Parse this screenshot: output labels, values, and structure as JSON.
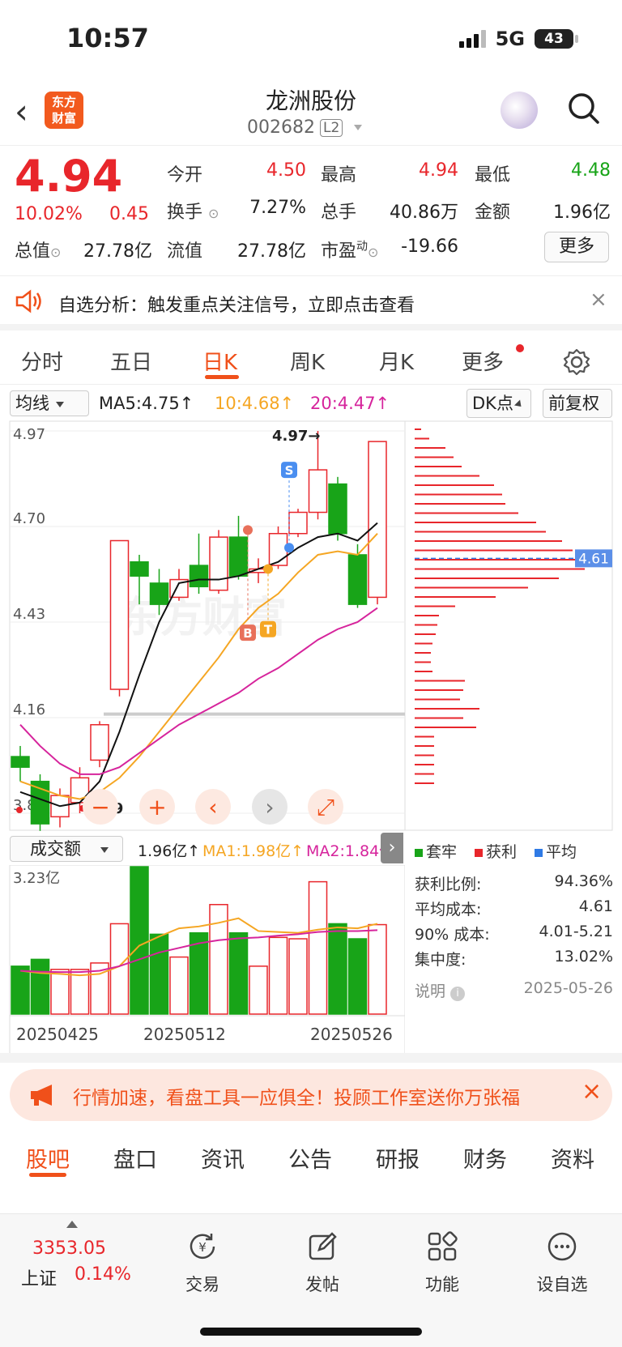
{
  "status_bar": {
    "time": "10:57",
    "network": "5G",
    "battery": "43"
  },
  "header": {
    "title": "龙洲股份",
    "code": "002682",
    "level_badge": "L2",
    "logo_text_line1": "东方",
    "logo_text_line2": "财富"
  },
  "quote": {
    "price": "4.94",
    "change_pct": "10.02%",
    "change_amt": "0.45",
    "open_label": "今开",
    "open": "4.50",
    "high_label": "最高",
    "high": "4.94",
    "low_label": "最低",
    "low": "4.48",
    "turnover_label": "换手",
    "turnover": "7.27%",
    "volume_label": "总手",
    "volume": "40.86万",
    "amount_label": "金额",
    "amount": "1.96亿",
    "total_cap_label": "总值",
    "total_cap": "27.78亿",
    "float_cap_label": "流值",
    "float_cap": "27.78亿",
    "pe_label": "市盈",
    "pe_super": "动",
    "pe": "-19.66",
    "more_button": "更多"
  },
  "alert_banner": {
    "text": "自选分析：触发重点关注信号，立即点击查看"
  },
  "chart_tabs": [
    "分时",
    "五日",
    "日K",
    "周K",
    "月K",
    "更多"
  ],
  "ma_bar": {
    "selector": "均线",
    "ma5": "MA5:4.75↑",
    "ma10": "10:4.68↑",
    "ma20": "20:4.47↑",
    "dk": "DK点",
    "adjust": "前复权"
  },
  "kline": {
    "y_labels": [
      "4.97",
      "4.70",
      "4.43",
      "4.16",
      "3.89"
    ],
    "high_marker": "4.97→",
    "low_marker": "3.89",
    "s_marker": "S",
    "b_marker": "B",
    "t_marker": "T",
    "cost_label": "4.61",
    "watermark": "东方财富"
  },
  "volume_bar": {
    "selector": "成交额",
    "value": "1.96亿↑",
    "ma1": "MA1:1.98亿↑",
    "ma2": "MA2:1.84亿↑",
    "max_label": "3.23亿"
  },
  "date_labels": [
    "20250425",
    "20250512",
    "20250526"
  ],
  "chip": {
    "legend": [
      "套牢",
      "获利",
      "平均"
    ],
    "profit_ratio_label": "获利比例:",
    "profit_ratio": "94.36%",
    "avg_cost_label": "平均成本:",
    "avg_cost": "4.61",
    "cost90_label": "90% 成本:",
    "cost90": "4.01-5.21",
    "concentration_label": "集中度:",
    "concentration": "13.02%",
    "note_label": "说明",
    "date": "2025-05-26"
  },
  "promo": {
    "text": "行情加速，看盘工具一应俱全！投顾工作室送你万张福"
  },
  "bottom_tabs": [
    "股吧",
    "盘口",
    "资讯",
    "公告",
    "研报",
    "财务",
    "资料"
  ],
  "bottom_nav": {
    "index_value": "3353.05",
    "index_name": "上证",
    "index_change": "0.14%",
    "items": [
      "交易",
      "发帖",
      "功能",
      "设自选"
    ]
  },
  "colors": {
    "up": "#e8262b",
    "down": "#18a418",
    "accent": "#f0501a",
    "ma10": "#f5a623",
    "ma20": "#d6249c"
  },
  "chart_data": {
    "type": "candlestick",
    "dates_shown": [
      "20250425",
      "20250512",
      "20250526"
    ],
    "ylim": [
      3.89,
      4.97
    ],
    "candles": [
      {
        "o": 4.05,
        "c": 4.02,
        "h": 4.08,
        "l": 3.98
      },
      {
        "o": 3.98,
        "c": 3.86,
        "h": 4.0,
        "l": 3.84
      },
      {
        "o": 3.88,
        "c": 3.94,
        "h": 3.96,
        "l": 3.85
      },
      {
        "o": 3.92,
        "c": 3.99,
        "h": 4.02,
        "l": 3.89
      },
      {
        "o": 4.04,
        "c": 4.14,
        "h": 4.15,
        "l": 4.02
      },
      {
        "o": 4.24,
        "c": 4.66,
        "h": 4.66,
        "l": 4.22
      },
      {
        "o": 4.6,
        "c": 4.56,
        "h": 4.62,
        "l": 4.48
      },
      {
        "o": 4.54,
        "c": 4.48,
        "h": 4.58,
        "l": 4.45
      },
      {
        "o": 4.5,
        "c": 4.55,
        "h": 4.58,
        "l": 4.49
      },
      {
        "o": 4.59,
        "c": 4.53,
        "h": 4.68,
        "l": 4.51
      },
      {
        "o": 4.52,
        "c": 4.67,
        "h": 4.69,
        "l": 4.51
      },
      {
        "o": 4.67,
        "c": 4.56,
        "h": 4.73,
        "l": 4.55
      },
      {
        "o": 4.57,
        "c": 4.58,
        "h": 4.61,
        "l": 4.54
      },
      {
        "o": 4.59,
        "c": 4.68,
        "h": 4.7,
        "l": 4.58
      },
      {
        "o": 4.68,
        "c": 4.74,
        "h": 4.75,
        "l": 4.67
      },
      {
        "o": 4.74,
        "c": 4.86,
        "h": 4.97,
        "l": 4.72
      },
      {
        "o": 4.82,
        "c": 4.68,
        "h": 4.84,
        "l": 4.66
      },
      {
        "o": 4.62,
        "c": 4.48,
        "h": 4.65,
        "l": 4.47
      },
      {
        "o": 4.5,
        "c": 4.94,
        "h": 4.94,
        "l": 4.48
      }
    ],
    "ma5": [
      3.95,
      3.93,
      3.91,
      3.92,
      3.98,
      4.12,
      4.28,
      4.43,
      4.54,
      4.55,
      4.55,
      4.56,
      4.58,
      4.6,
      4.64,
      4.67,
      4.68,
      4.66,
      4.71
    ],
    "ma10": [
      3.98,
      3.96,
      3.94,
      3.93,
      3.95,
      3.99,
      4.05,
      4.12,
      4.19,
      4.26,
      4.33,
      4.41,
      4.47,
      4.51,
      4.57,
      4.62,
      4.63,
      4.62,
      4.68
    ],
    "ma20": [
      4.14,
      4.08,
      4.03,
      4.0,
      4.0,
      4.02,
      4.06,
      4.1,
      4.14,
      4.17,
      4.2,
      4.23,
      4.27,
      4.3,
      4.34,
      4.38,
      4.41,
      4.43,
      4.47
    ],
    "volumes": [
      1.05,
      1.2,
      0.98,
      0.98,
      1.12,
      1.98,
      3.23,
      1.75,
      1.25,
      1.78,
      2.4,
      1.78,
      1.05,
      1.68,
      1.65,
      2.9,
      1.98,
      1.65,
      1.96
    ],
    "vol_ma1": [
      0.95,
      0.9,
      0.88,
      0.85,
      0.88,
      1.05,
      1.5,
      1.7,
      1.88,
      1.92,
      2.0,
      2.1,
      1.82,
      1.8,
      1.78,
      1.85,
      1.9,
      1.88,
      1.98
    ],
    "vol_ma2": [
      0.95,
      0.93,
      0.92,
      0.92,
      0.95,
      1.05,
      1.2,
      1.35,
      1.45,
      1.55,
      1.62,
      1.66,
      1.68,
      1.72,
      1.75,
      1.8,
      1.82,
      1.82,
      1.84
    ]
  }
}
